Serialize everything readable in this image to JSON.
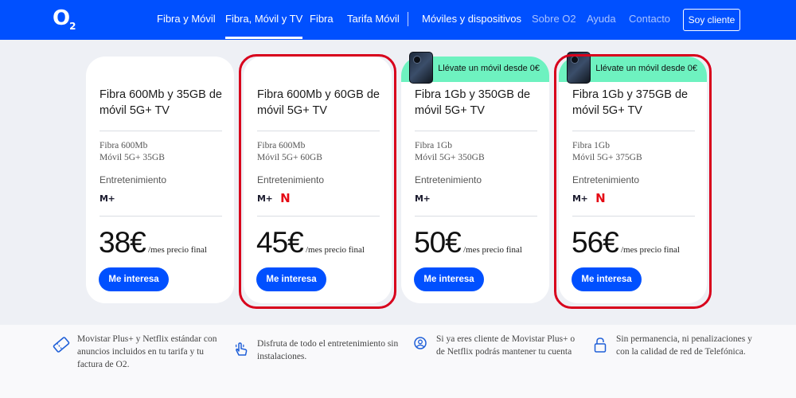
{
  "header": {
    "logo": "O",
    "logo_sub": "2",
    "nav": [
      {
        "label": "Fibra y Móvil"
      },
      {
        "label": "Fibra, Móvil y TV"
      },
      {
        "label": "Fibra"
      },
      {
        "label": "Tarifa Móvil"
      },
      {
        "label": "Móviles y dispositivos"
      },
      {
        "label": "Sobre O2"
      },
      {
        "label": "Ayuda"
      },
      {
        "label": "Contacto"
      }
    ],
    "login_label": "Soy cliente"
  },
  "cards": [
    {
      "title": "Fibra 600Mb y 35GB de móvil 5G+ TV",
      "spec1": "Fibra 600Mb",
      "spec2": "Móvil 5G+ 35GB",
      "ent_label": "Entretenimiento",
      "movistar": "M+",
      "price": "38€",
      "price_note": "/mes precio final",
      "cta": "Me interesa"
    },
    {
      "title": "Fibra 600Mb y 60GB de móvil 5G+ TV",
      "spec1": "Fibra 600Mb",
      "spec2": "Móvil 5G+ 60GB",
      "ent_label": "Entretenimiento",
      "movistar": "M+",
      "netflix": "N",
      "price": "45€",
      "price_note": "/mes precio final",
      "cta": "Me interesa"
    },
    {
      "promo": "Llévate un móvil desde 0€",
      "title": "Fibra 1Gb y 350GB de móvil 5G+ TV",
      "spec1": "Fibra 1Gb",
      "spec2": "Móvil 5G+ 350GB",
      "ent_label": "Entretenimiento",
      "movistar": "M+",
      "price": "50€",
      "price_note": "/mes precio final",
      "cta": "Me interesa"
    },
    {
      "promo": "Llévate un móvil desde 0€",
      "title": "Fibra 1Gb y 375GB de móvil 5G+ TV",
      "spec1": "Fibra 1Gb",
      "spec2": "Móvil 5G+ 375GB",
      "ent_label": "Entretenimiento",
      "movistar": "M+",
      "netflix": "N",
      "price": "56€",
      "price_note": "/mes precio final",
      "cta": "Me interesa"
    }
  ],
  "features": [
    {
      "text": "Movistar Plus+ y Netflix estándar con anuncios incluidos en tu tarifa y tu factura de O2.",
      "icon": "ticket-icon"
    },
    {
      "text": "Disfruta de todo el entretenimiento sin instalaciones.",
      "icon": "hand-tap-icon"
    },
    {
      "text": "Si ya eres cliente de Movistar Plus+ o de Netflix podrás mantener tu cuenta",
      "icon": "user-account-icon"
    },
    {
      "text": "Sin permanencia, ni penalizaciones y con la calidad de red de Telefónica.",
      "icon": "padlock-icon"
    }
  ],
  "colors": {
    "brand_blue": "#0050ff",
    "promo_green": "#6ef2c0",
    "highlight_red": "#d8001c",
    "netflix_red": "#e50914"
  }
}
